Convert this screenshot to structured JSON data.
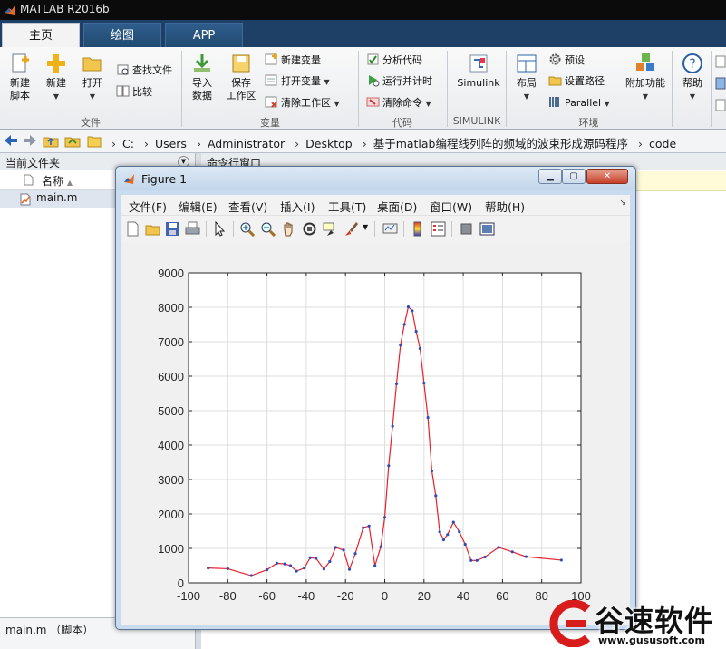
{
  "app": {
    "title": "MATLAB R2016b",
    "tabs": [
      "主页",
      "绘图",
      "APP"
    ]
  },
  "ribbon": {
    "file_group": {
      "label": "文件",
      "new_script": "新建\n脚本",
      "new": "新建",
      "open": "打开",
      "find_files": "查找文件",
      "compare": "比较"
    },
    "variable_group": {
      "label": "变量",
      "import": "导入\n数据",
      "save_ws": "保存\n工作区",
      "new_var": "新建变量",
      "open_var": "打开变量",
      "clear_ws": "清除工作区"
    },
    "code_group": {
      "label": "代码",
      "analyze": "分析代码",
      "run_time": "运行并计时",
      "clear_cmd": "清除命令"
    },
    "simulink_group": {
      "label": "SIMULINK",
      "simulink": "Simulink"
    },
    "env_group": {
      "label": "环境",
      "layout": "布局",
      "preferences": "预设",
      "set_path": "设置路径",
      "parallel": "Parallel",
      "addons": "附加功能"
    },
    "help": "帮助"
  },
  "address": {
    "crumbs": [
      "C:",
      "Users",
      "Administrator",
      "Desktop",
      "基于matlab编程线列阵的频域的波束形成源码程序",
      "code"
    ]
  },
  "left_panel": {
    "title": "当前文件夹",
    "col_name": "名称",
    "file": "main.m",
    "status": "main.m （脚本）"
  },
  "cmd_panel": {
    "title": "命令行窗口"
  },
  "figure": {
    "title": "Figure 1",
    "menu": [
      "文件(F)",
      "编辑(E)",
      "查看(V)",
      "插入(I)",
      "工具(T)",
      "桌面(D)",
      "窗口(W)",
      "帮助(H)"
    ],
    "toolbar_icons": [
      "new-figure-icon",
      "open-icon",
      "save-icon",
      "print-icon",
      "pointer-icon",
      "zoom-in-icon",
      "zoom-out-icon",
      "pan-icon",
      "rotate-icon",
      "data-cursor-icon",
      "brush-icon",
      "link-icon",
      "colorbar-icon",
      "legend-icon",
      "hide-tools-icon",
      "dock-icon"
    ]
  },
  "chart_data": {
    "type": "line",
    "title": "",
    "xlabel": "",
    "ylabel": "",
    "xlim": [
      -100,
      100
    ],
    "ylim": [
      0,
      9000
    ],
    "xticks": [
      -100,
      -80,
      -60,
      -40,
      -20,
      0,
      20,
      40,
      60,
      80,
      100
    ],
    "yticks": [
      0,
      1000,
      2000,
      3000,
      4000,
      5000,
      6000,
      7000,
      8000,
      9000
    ],
    "grid": true,
    "line_color": "#e8202a",
    "marker_color": "#2b4dbf",
    "series": [
      {
        "x": [
          -90,
          -80,
          -68,
          -60,
          -55,
          -51,
          -48,
          -45,
          -41,
          -38,
          -35,
          -31,
          -28,
          -25,
          -21,
          -18,
          -15,
          -11,
          -8,
          -5,
          -2,
          0,
          2,
          4,
          6,
          8,
          10,
          12,
          14,
          16,
          18,
          20,
          22,
          24,
          26,
          28,
          30,
          32,
          35,
          38,
          41,
          44,
          47,
          51,
          58,
          65,
          72,
          90
        ],
        "y": [
          430,
          410,
          210,
          380,
          570,
          550,
          500,
          340,
          430,
          730,
          710,
          400,
          620,
          1030,
          950,
          390,
          850,
          1600,
          1650,
          500,
          1050,
          1900,
          3400,
          4550,
          5780,
          6900,
          7500,
          8010,
          7900,
          7300,
          6800,
          5800,
          4800,
          3250,
          2530,
          1480,
          1250,
          1400,
          1760,
          1480,
          1120,
          650,
          650,
          750,
          1030,
          900,
          760,
          660
        ]
      }
    ]
  },
  "watermark": {
    "brand": "谷速软件",
    "url": "www.gususoft.com"
  }
}
